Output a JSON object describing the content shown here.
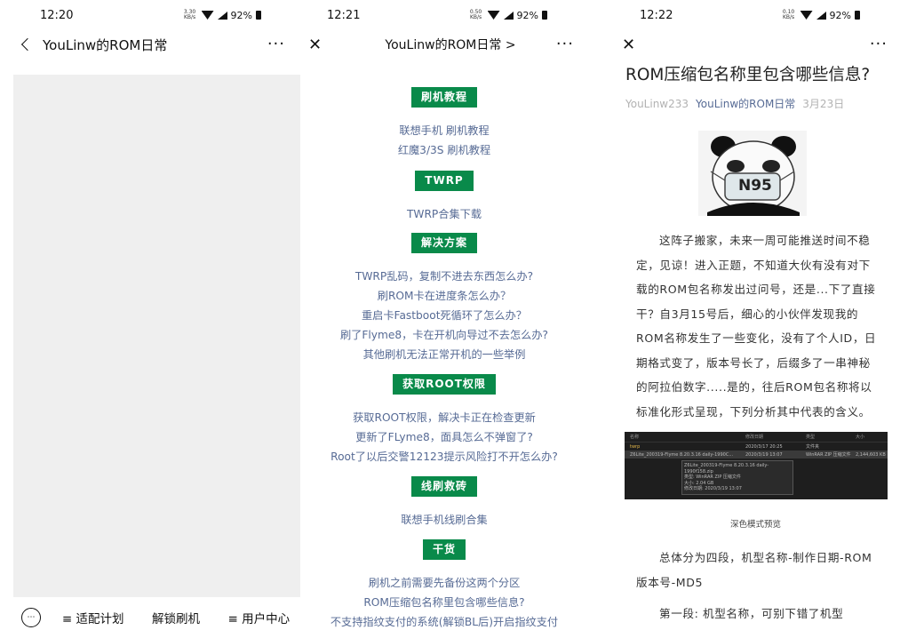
{
  "panel1": {
    "time": "12:20",
    "speed": "3.30 KB/s",
    "battery": "92%",
    "title": "YouLinw的ROM日常",
    "more": "···",
    "bottom_menu": [
      "≡ 适配计划",
      "解锁刷机",
      "≡ 用户中心"
    ]
  },
  "panel2": {
    "time": "12:21",
    "speed": "0.50 KB/s",
    "battery": "92%",
    "title": "YouLinw的ROM日常 >",
    "more": "···",
    "sections": [
      {
        "title": "刷机教程",
        "items": [
          "联想手机 刷机教程",
          "红魔3/3S 刷机教程"
        ]
      },
      {
        "title": "TWRP",
        "items": [
          "TWRP合集下载"
        ]
      },
      {
        "title": "解决方案",
        "items": [
          "TWRP乱码，复制不进去东西怎么办?",
          "刷ROM卡在进度条怎么办？",
          "重启卡Fastboot死循环了怎么办？",
          "刷了Flyme8，卡在开机向导过不去怎么办?",
          "其他刷机无法正常开机的一些举例"
        ]
      },
      {
        "title": "获取ROOT权限",
        "items": [
          "获取ROOT权限，解决卡正在检查更新",
          "更新了FLyme8，面具怎么不弹窗了?",
          "Root了以后交警12123提示风险打不开怎么办?"
        ]
      },
      {
        "title": "线刷救砖",
        "items": [
          "联想手机线刷合集"
        ]
      },
      {
        "title": "干货",
        "items": [
          "刷机之前需要先备份这两个分区",
          "ROM压缩包名称里包含哪些信息?",
          "不支持指纹支付的系统(解锁BL后)开启指纹支付"
        ]
      }
    ]
  },
  "panel3": {
    "time": "12:22",
    "speed": "0.10 KB/s",
    "battery": "92%",
    "more": "···",
    "article_title": "ROM压缩包名称里包含哪些信息?",
    "author": "YouLinw233",
    "account": "YouLinw的ROM日常",
    "date": "3月23日",
    "mask_text": "N95",
    "paragraph1": "这阵子搬家，未来一周可能推送时间不稳定，见谅！进入正题，不知道大伙有没有对下载的ROM包名称发出过问号，还是...下了直接干？自3月15号后，细心的小伙伴发现我的ROM名称发生了一些变化，没有了个人ID，日期格式变了，版本号长了，后缀多了一串神秘的阿拉伯数字.....是的，往后ROM包名称将以标准化形式呈现，下列分析其中代表的含义。",
    "screenshot": {
      "headers": [
        "名称",
        "修改日期",
        "类型",
        "大小"
      ],
      "row1": [
        "twrp",
        "2020/3/17 20:25",
        "文件夹",
        ""
      ],
      "row2": [
        "Z6Lite_200319-Flyme 8.20.3.16 daily-1990C...",
        "2020/3/19 13:07",
        "WinRAR ZIP 压缩文件",
        "2,144,603 KB"
      ],
      "tooltip": [
        "Z6Lite_200319-Flyme 8.20.3.16 daily-1990f158.zip",
        "类型: WinRAR ZIP 压缩文件",
        "大小: 2.04 GB",
        "修改日期: 2020/3/19 13:07"
      ]
    },
    "caption": "深色模式预览",
    "paragraph2": "总体分为四段，机型名称-制作日期-ROM版本号-MD5",
    "paragraph3": "第一段: 机型名称，可别下错了机型"
  }
}
